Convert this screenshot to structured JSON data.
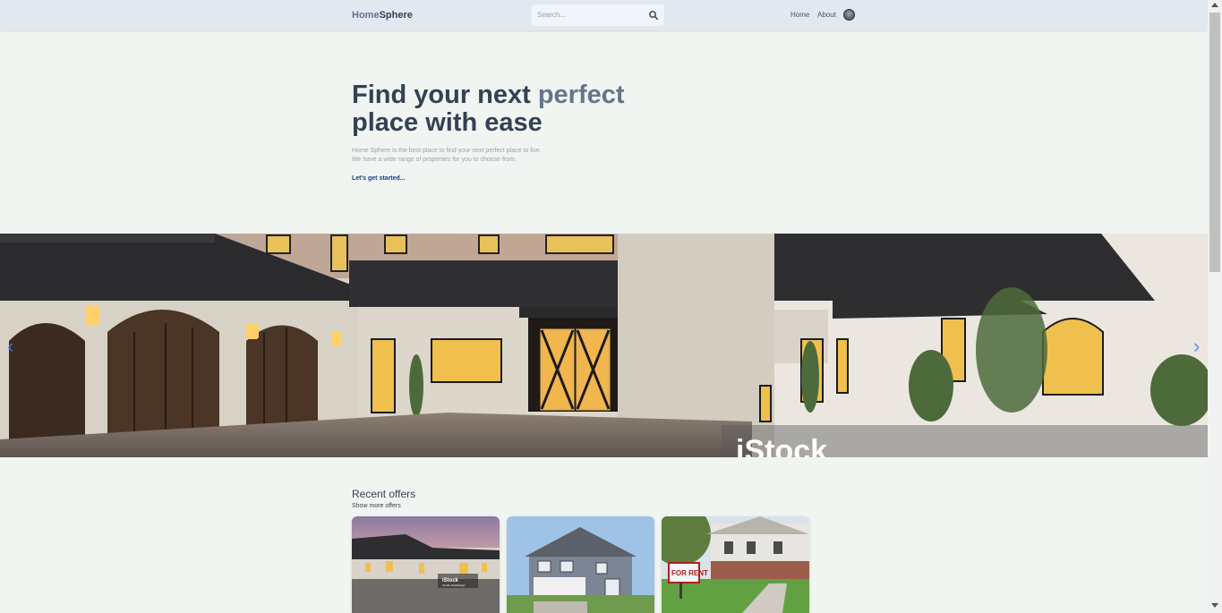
{
  "header": {
    "logo_part1": "Home",
    "logo_part2": "Sphere",
    "search_placeholder": "Search...",
    "nav": {
      "home": "Home",
      "about": "About"
    }
  },
  "hero": {
    "title_part1": "Find your next ",
    "title_highlight": "perfect",
    "title_part2": "place with ease",
    "description_line1": "Home Sphere is the best place to find your next perfect place to live.",
    "description_line2": "We have a wide range of properties for you to choose from.",
    "cta": "Let's get started..."
  },
  "banner": {
    "watermark": "iStock",
    "prev_arrow": "‹",
    "next_arrow": "›"
  },
  "offers": {
    "title": "Recent offers",
    "show_more": "Show more offers",
    "cards": [
      {
        "alt": "Stone mansion at dusk",
        "watermark": "iStock",
        "watermark_sub": "Credit: ArtistDesign"
      },
      {
        "alt": "Gray two-story house with garage"
      },
      {
        "alt": "House with for rent sign",
        "sign": "FOR RENT"
      }
    ]
  },
  "colors": {
    "page_bg": "#f1f5f1",
    "header_bg": "#e2e8f0",
    "title": "#334155",
    "highlight": "#64748b",
    "link": "#1e3a8a",
    "arrow": "#3b82f6"
  }
}
